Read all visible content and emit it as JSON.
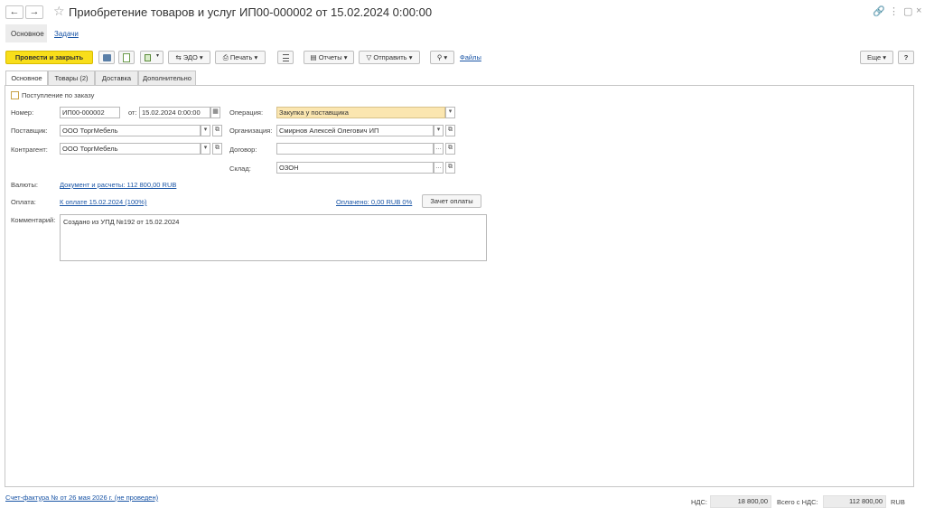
{
  "window": {
    "title": "Приобретение товаров и услуг ИП00-000002 от 15.02.2024 0:00:00"
  },
  "nav": {
    "back": "←",
    "forward": "→",
    "tabs": [
      {
        "label": "Основное"
      },
      {
        "label": "Задачи"
      }
    ]
  },
  "toolbar": {
    "post_close": "Провести и закрыть",
    "edo": "ЭДО",
    "print": "Печать",
    "reports": "Отчеты",
    "send": "Отправить",
    "files": "Файлы",
    "more": "Еще",
    "help": "?"
  },
  "form_tabs": [
    {
      "label": "Основное"
    },
    {
      "label": "Товары (2)"
    },
    {
      "label": "Доставка"
    },
    {
      "label": "Дополнительно"
    }
  ],
  "form": {
    "by_order_label": "Поступление по заказу",
    "number_label": "Номер:",
    "number_value": "ИП00-000002",
    "date_label": "от:",
    "date_value": "15.02.2024  0:00:00",
    "operation_label": "Операция:",
    "operation_value": "Закупка у поставщика",
    "supplier_label": "Поставщик:",
    "supplier_value": "ООО ТоргМебель",
    "organization_label": "Организация:",
    "organization_value": "Смирнов Алексей Олегович ИП",
    "counterparty_label": "Контрагент:",
    "counterparty_value": "ООО ТоргМебель",
    "contract_label": "Договор:",
    "contract_value": "",
    "warehouse_label": "Склад:",
    "warehouse_value": "ОЗОН",
    "currency_label": "Валюты:",
    "currency_link": "Документ и расчеты: 112 800,00 RUB",
    "payment_label": "Оплата:",
    "payment_link": "К оплате 15.02.2024 (100%)",
    "paid_link": "Оплачено: 0,00 RUB 0%",
    "offset_button": "Зачет оплаты",
    "comment_label": "Комментарий:",
    "comment_value": "Создано из УПД №192 от 15.02.2024"
  },
  "footer": {
    "invoice_link": "Счет-фактура №  от 26 мая 2026 г. (не проведен)",
    "vat_label": "НДС:",
    "vat_value": "18 800,00",
    "total_label": "Всего с НДС:",
    "total_value": "112 800,00",
    "currency": "RUB"
  },
  "colors": {
    "primary_button": "#f8de1a",
    "operation_field": "#fbe6b0",
    "link": "#1a55a6"
  }
}
